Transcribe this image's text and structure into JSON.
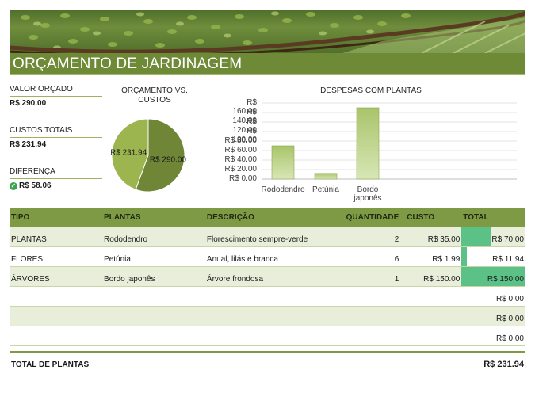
{
  "header": {
    "title": "ORÇAMENTO DE JARDINAGEM"
  },
  "kpis": {
    "budget_label": "VALOR ORÇADO",
    "budget_value": "R$ 290.00",
    "costs_label": "CUSTOS TOTAIS",
    "costs_value": "R$ 231.94",
    "diff_label": "DIFERENÇA",
    "diff_value": "R$ 58.06"
  },
  "colors": {
    "accent": "#6f8a37",
    "header_row": "#7f9a45",
    "band": "#e8eed9",
    "databar": "#5cc187",
    "pie_costs": "#9db54f",
    "pie_budget": "#6f8637"
  },
  "chart_data": [
    {
      "type": "pie",
      "title": "ORÇAMENTO VS. CUSTOS",
      "slices": [
        {
          "label": "R$ 231.94",
          "value": 231.94
        },
        {
          "label": "R$ 290.00",
          "value": 290.0
        }
      ]
    },
    {
      "type": "bar",
      "title": "DESPESAS COM PLANTAS",
      "categories": [
        "Rododendro",
        "Petúnia",
        "Bordo japonês"
      ],
      "values": [
        70.0,
        11.94,
        150.0
      ],
      "ylim": [
        0,
        160
      ],
      "yticks": [
        "R$ 0.00",
        "R$ 20.00",
        "R$ 40.00",
        "R$ 60.00",
        "R$ 80.00",
        "R$ 100.00",
        "R$ 120.00",
        "R$ 140.00",
        "R$ 160.00"
      ],
      "grid": true
    }
  ],
  "table": {
    "headers": [
      "TIPO",
      "PLANTAS",
      "DESCRIÇÃO",
      "QUANTIDADE",
      "CUSTO",
      "TOTAL"
    ],
    "rows": [
      {
        "tipo": "PLANTAS",
        "planta": "Rododendro",
        "descricao": "Florescimento sempre-verde",
        "quantidade": "2",
        "custo": "R$ 35.00",
        "total": "R$ 70.00",
        "total_value": 70.0
      },
      {
        "tipo": "FLORES",
        "planta": "Petúnia",
        "descricao": "Anual, lilás e branca",
        "quantidade": "6",
        "custo": "R$ 1.99",
        "total": "R$ 11.94",
        "total_value": 11.94
      },
      {
        "tipo": "ÁRVORES",
        "planta": "Bordo japonês",
        "descricao": "Árvore frondosa",
        "quantidade": "1",
        "custo": "R$ 150.00",
        "total": "R$ 150.00",
        "total_value": 150.0
      },
      {
        "tipo": "",
        "planta": "",
        "descricao": "",
        "quantidade": "",
        "custo": "",
        "total": "R$ 0.00",
        "total_value": 0
      },
      {
        "tipo": "",
        "planta": "",
        "descricao": "",
        "quantidade": "",
        "custo": "",
        "total": "R$ 0.00",
        "total_value": 0
      },
      {
        "tipo": "",
        "planta": "",
        "descricao": "",
        "quantidade": "",
        "custo": "",
        "total": "R$ 0.00",
        "total_value": 0
      }
    ],
    "total_label": "TOTAL DE PLANTAS",
    "total_value": "R$ 231.94"
  }
}
